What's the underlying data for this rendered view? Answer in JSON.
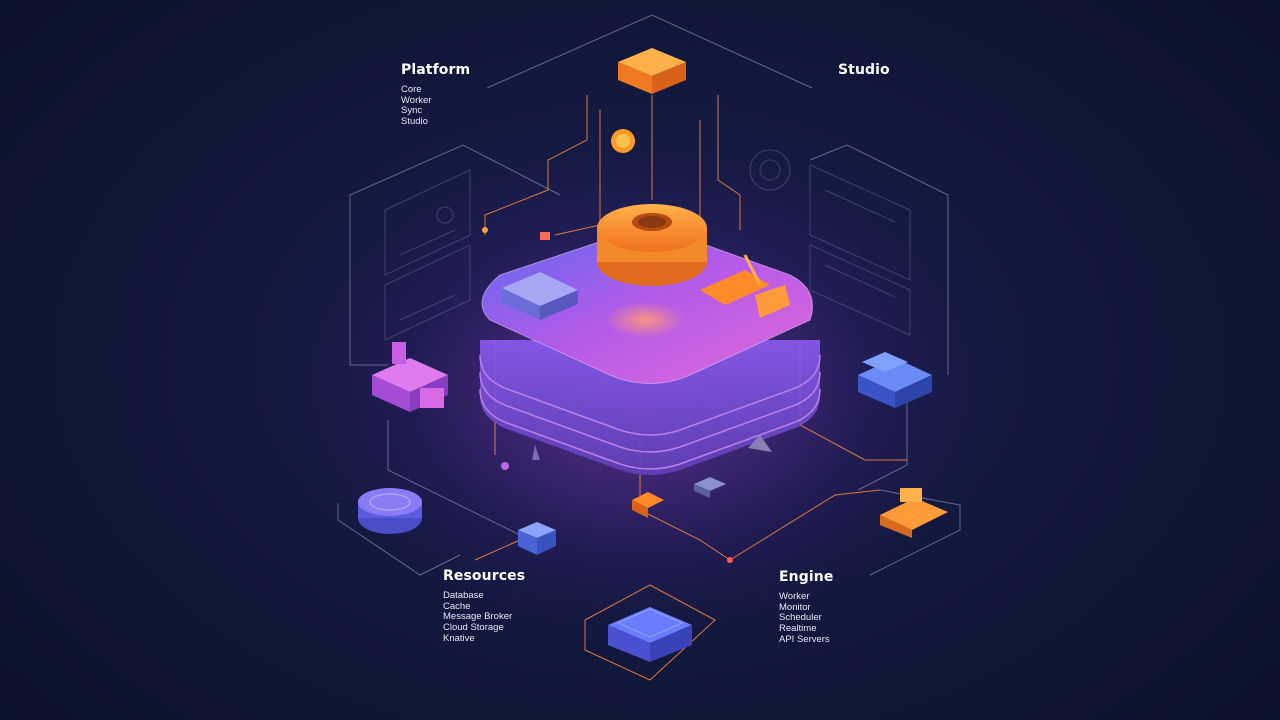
{
  "platform": {
    "title": "Platform",
    "items": [
      "Core",
      "Worker",
      "Sync",
      "Studio"
    ]
  },
  "studio": {
    "title": "Studio",
    "items": []
  },
  "resources": {
    "title": "Resources",
    "items": [
      "Database",
      "Cache",
      "Message Broker",
      "Cloud Storage",
      "Knative"
    ]
  },
  "engine": {
    "title": "Engine",
    "items": [
      "Worker",
      "Monitor",
      "Scheduler",
      "Realtime",
      "API Servers"
    ]
  },
  "colors": {
    "background": "#0d1530",
    "accent_orange": "#ff8a2a",
    "accent_purple": "#8a5cf5",
    "accent_blue": "#4b63e8",
    "line_gray": "#8a90a8"
  },
  "icons": [
    "gear-ring-icon",
    "server-icon",
    "database-icon",
    "gauge-icon",
    "chip-icon",
    "cube-icon",
    "forklift-icon"
  ]
}
